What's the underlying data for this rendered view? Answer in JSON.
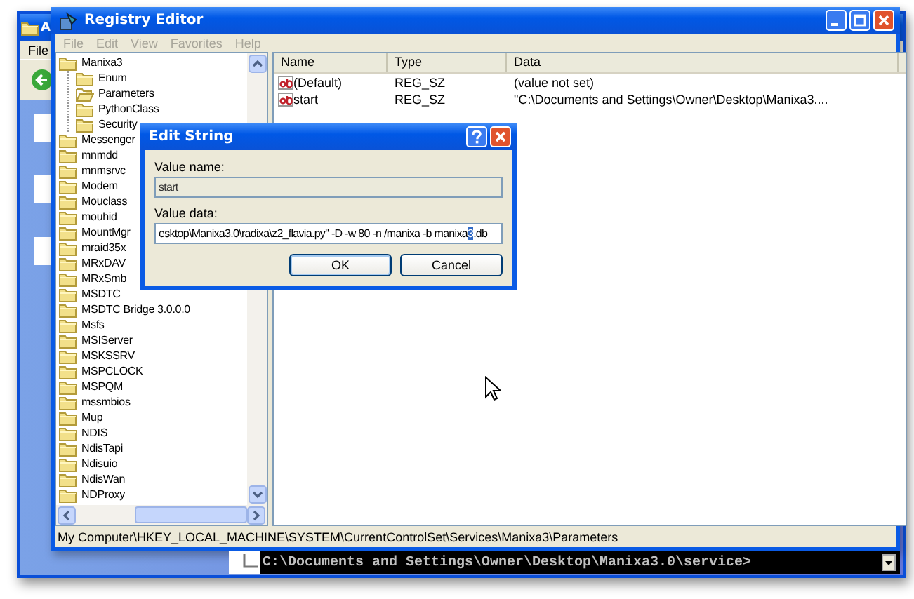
{
  "explorer": {
    "title": "A",
    "menu": [
      "File"
    ]
  },
  "window": {
    "title": "Registry Editor",
    "menu": [
      "File",
      "Edit",
      "View",
      "Favorites",
      "Help"
    ]
  },
  "tree": {
    "items": [
      {
        "label": "Manixa3",
        "selected": false,
        "children": [
          {
            "label": "Enum",
            "selected": false
          },
          {
            "label": "Parameters",
            "selected": true
          },
          {
            "label": "PythonClass",
            "selected": false
          },
          {
            "label": "Security",
            "selected": false
          }
        ]
      },
      {
        "label": "Messenger",
        "selected": false
      },
      {
        "label": "mnmdd",
        "selected": false
      },
      {
        "label": "mnmsrvc",
        "selected": false
      },
      {
        "label": "Modem",
        "selected": false
      },
      {
        "label": "Mouclass",
        "selected": false
      },
      {
        "label": "mouhid",
        "selected": false
      },
      {
        "label": "MountMgr",
        "selected": false
      },
      {
        "label": "mraid35x",
        "selected": false
      },
      {
        "label": "MRxDAV",
        "selected": false
      },
      {
        "label": "MRxSmb",
        "selected": false
      },
      {
        "label": "MSDTC",
        "selected": false
      },
      {
        "label": "MSDTC Bridge 3.0.0.0",
        "selected": false
      },
      {
        "label": "Msfs",
        "selected": false
      },
      {
        "label": "MSIServer",
        "selected": false
      },
      {
        "label": "MSKSSRV",
        "selected": false
      },
      {
        "label": "MSPCLOCK",
        "selected": false
      },
      {
        "label": "MSPQM",
        "selected": false
      },
      {
        "label": "mssmbios",
        "selected": false
      },
      {
        "label": "Mup",
        "selected": false
      },
      {
        "label": "NDIS",
        "selected": false
      },
      {
        "label": "NdisTapi",
        "selected": false
      },
      {
        "label": "Ndisuio",
        "selected": false
      },
      {
        "label": "NdisWan",
        "selected": false
      },
      {
        "label": "NDProxy",
        "selected": false
      }
    ]
  },
  "list": {
    "columns": [
      "Name",
      "Type",
      "Data"
    ],
    "rows": [
      {
        "name": "(Default)",
        "type": "REG_SZ",
        "data": "(value not set)"
      },
      {
        "name": "start",
        "type": "REG_SZ",
        "data": "\"C:\\Documents and Settings\\Owner\\Desktop\\Manixa3...."
      }
    ]
  },
  "status_bar": "My Computer\\HKEY_LOCAL_MACHINE\\SYSTEM\\CurrentControlSet\\Services\\Manixa3\\Parameters",
  "dialog": {
    "title": "Edit String",
    "fields": [
      {
        "label": "Value name:",
        "disabled": true,
        "segments": [
          {
            "text": "start",
            "selected": false
          }
        ]
      },
      {
        "label": "Value data:",
        "disabled": false,
        "segments": [
          {
            "text": "esktop\\Manixa3.0\\radixa\\z2_flavia.py\" -D -w 80 -n /manixa -b manixa",
            "selected": false
          },
          {
            "text": "3",
            "selected": true
          },
          {
            "text": ".db",
            "selected": false
          }
        ]
      }
    ],
    "buttons": [
      {
        "label": "OK",
        "default": true
      },
      {
        "label": "Cancel",
        "default": false
      }
    ]
  },
  "console": {
    "text": "C:\\Documents and Settings\\Owner\\Desktop\\Manixa3.0\\service>"
  }
}
